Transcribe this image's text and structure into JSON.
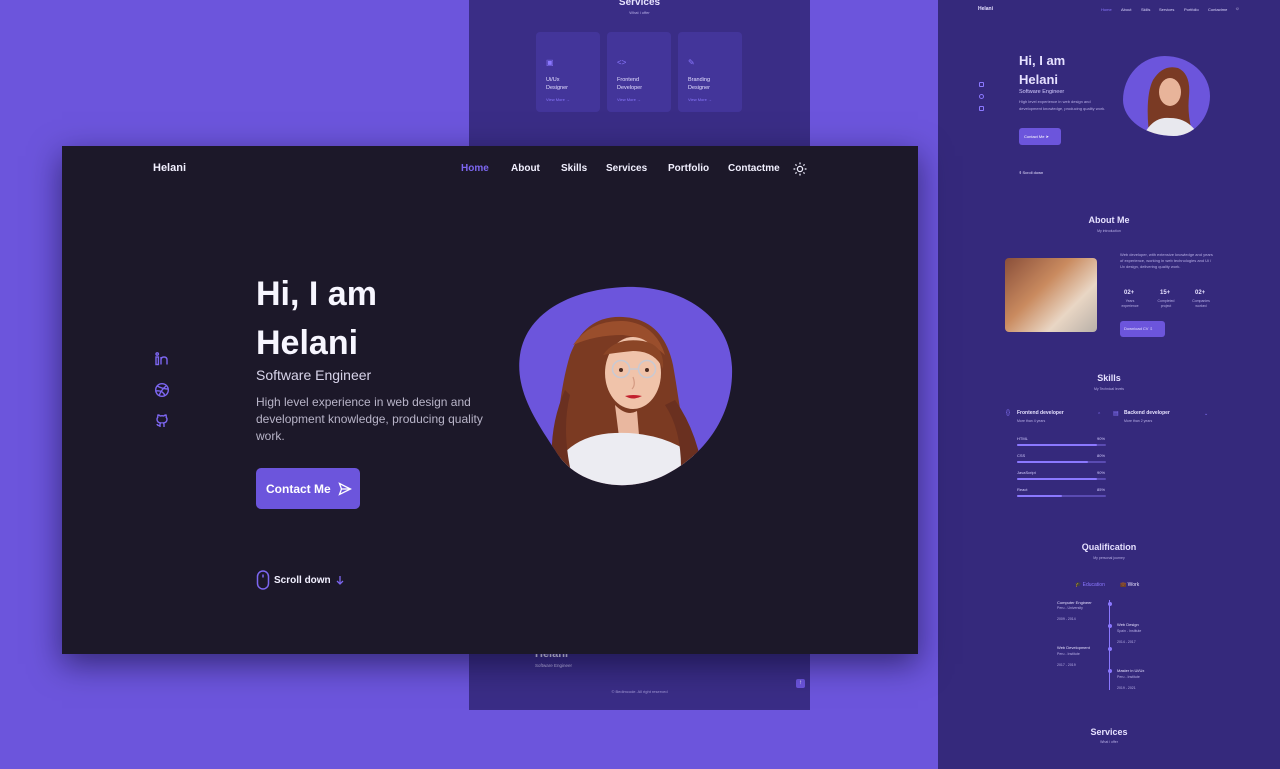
{
  "colors": {
    "accent": "#6c55dc",
    "dark_bg": "#1c1829",
    "page_bg": "#6c55dc",
    "preview_bg": "#35297c"
  },
  "middle_preview": {
    "section_title": "Services",
    "section_subtitle": "What i offer",
    "cards": [
      {
        "icon": "square-icon",
        "label_line1": "Ui/Ux",
        "label_line2": "Designer",
        "link": "View More →"
      },
      {
        "icon": "code-icon",
        "label_line1": "Frontend",
        "label_line2": "Developer",
        "link": "View More →"
      },
      {
        "icon": "pencil-icon",
        "label_line1": "Branding",
        "label_line2": "Designer",
        "link": "View More →"
      }
    ],
    "footer_name": "Helani",
    "footer_role": "Software Engineer",
    "footer_copy": "© Bedimcode. All right reserved",
    "footer_up": "↑"
  },
  "right_preview": {
    "brand": "Helani",
    "nav": [
      "Home",
      "About",
      "Skills",
      "Services",
      "Portfolio",
      "Contactme"
    ],
    "hello_line1": "Hi, I am",
    "hello_line2": "Helani",
    "role": "Software Engineer",
    "desc": "High level experience in web design and development knowledge, producing quality work.",
    "button": "Contact Me",
    "scroll": "Scroll down",
    "about_title": "About Me",
    "about_subtitle": "My introduction",
    "about_text": "Web developer, with extensive knowledge and years of experience, working in web technologies and Ui / Ux design, delivering quality work.",
    "stats": [
      {
        "num": "02+",
        "label": "Years experience"
      },
      {
        "num": "15+",
        "label": "Completed project"
      },
      {
        "num": "02+",
        "label": "Companies worked"
      }
    ],
    "download": "Download CV",
    "skills_title": "Skills",
    "skills_subtitle": "My Technical levels",
    "frontend_title": "Frontend developer",
    "frontend_sub": "More than 4 years",
    "backend_title": "Backend developer",
    "backend_sub": "More than 2 years",
    "skills": [
      {
        "name": "HTML",
        "pct": "90%",
        "level": 0.9
      },
      {
        "name": "CSS",
        "pct": "80%",
        "level": 0.8
      },
      {
        "name": "JavaScript",
        "pct": "90%",
        "level": 0.9
      },
      {
        "name": "React",
        "pct": "85%",
        "level": 0.5
      }
    ],
    "qual_title": "Qualification",
    "qual_subtitle": "My personal journey",
    "tab_education": "Education",
    "tab_work": "Work",
    "qual_items": [
      {
        "title": "Computer Engineer",
        "sub": "Peru - University",
        "date": "2009 - 2014"
      },
      {
        "title": "Web Design",
        "sub": "Spain - Institute",
        "date": "2014 - 2017"
      },
      {
        "title": "Web Development",
        "sub": "Peru - Institute",
        "date": "2017 - 2019"
      },
      {
        "title": "Master in Ui/Ux",
        "sub": "Peru - Institute",
        "date": "2019 - 2021"
      }
    ],
    "services_title": "Services",
    "services_subtitle": "What i offer"
  },
  "main": {
    "logo": "Helani",
    "nav": {
      "home": "Home",
      "about": "About",
      "skills": "Skills",
      "services": "Services",
      "portfolio": "Portfolio",
      "contact": "Contactme"
    },
    "hello_line1": "Hi, I am",
    "hello_line2": "Helani",
    "role": "Software Engineer",
    "description": "High level experience in web design and development knowledge, producing quality work.",
    "contact_button": "Contact Me",
    "scroll_down": "Scroll down",
    "social_icons": [
      "linkedin-icon",
      "dribbble-icon",
      "github-icon"
    ]
  }
}
